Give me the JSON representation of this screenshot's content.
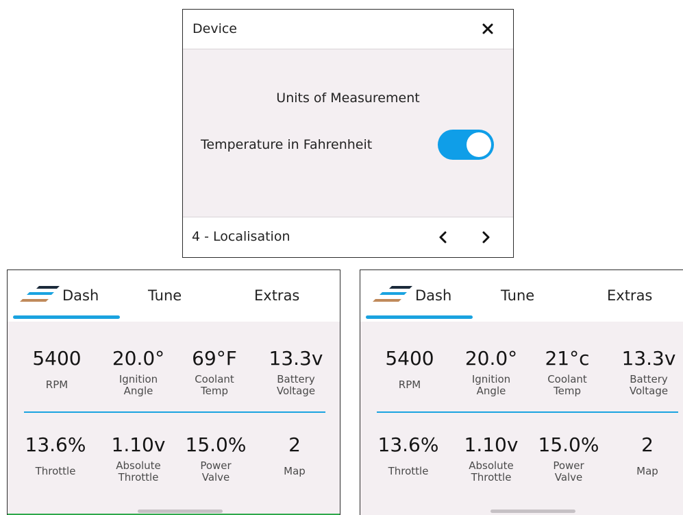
{
  "dialog": {
    "title": "Device",
    "section_title": "Units of Measurement",
    "option_label": "Temperature in Fahrenheit",
    "option_on": true,
    "footer_label": "4 - Localisation"
  },
  "colors": {
    "accent": "#1aa3e0",
    "toggle_on": "#0f9ee8",
    "panel_bg": "#f4eff2"
  },
  "panels": [
    {
      "tabs": {
        "dash": "Dash",
        "tune": "Tune",
        "extras": "Extras"
      },
      "metrics": [
        {
          "value": "5400",
          "label": "RPM"
        },
        {
          "value": "20.0°",
          "label": "Ignition Angle"
        },
        {
          "value": "69°F",
          "label": "Coolant Temp"
        },
        {
          "value": "13.3v",
          "label": "Battery Voltage"
        },
        {
          "value": "13.6%",
          "label": "Throttle"
        },
        {
          "value": "1.10v",
          "label": "Absolute Throttle"
        },
        {
          "value": "15.0%",
          "label": "Power Valve"
        },
        {
          "value": "2",
          "label": "Map"
        }
      ]
    },
    {
      "tabs": {
        "dash": "Dash",
        "tune": "Tune",
        "extras": "Extras"
      },
      "metrics": [
        {
          "value": "5400",
          "label": "RPM"
        },
        {
          "value": "20.0°",
          "label": "Ignition Angle"
        },
        {
          "value": "21°c",
          "label": "Coolant Temp"
        },
        {
          "value": "13.3v",
          "label": "Battery Voltage"
        },
        {
          "value": "13.6%",
          "label": "Throttle"
        },
        {
          "value": "1.10v",
          "label": "Absolute Throttle"
        },
        {
          "value": "15.0%",
          "label": "Power Valve"
        },
        {
          "value": "2",
          "label": "Map"
        }
      ]
    }
  ]
}
